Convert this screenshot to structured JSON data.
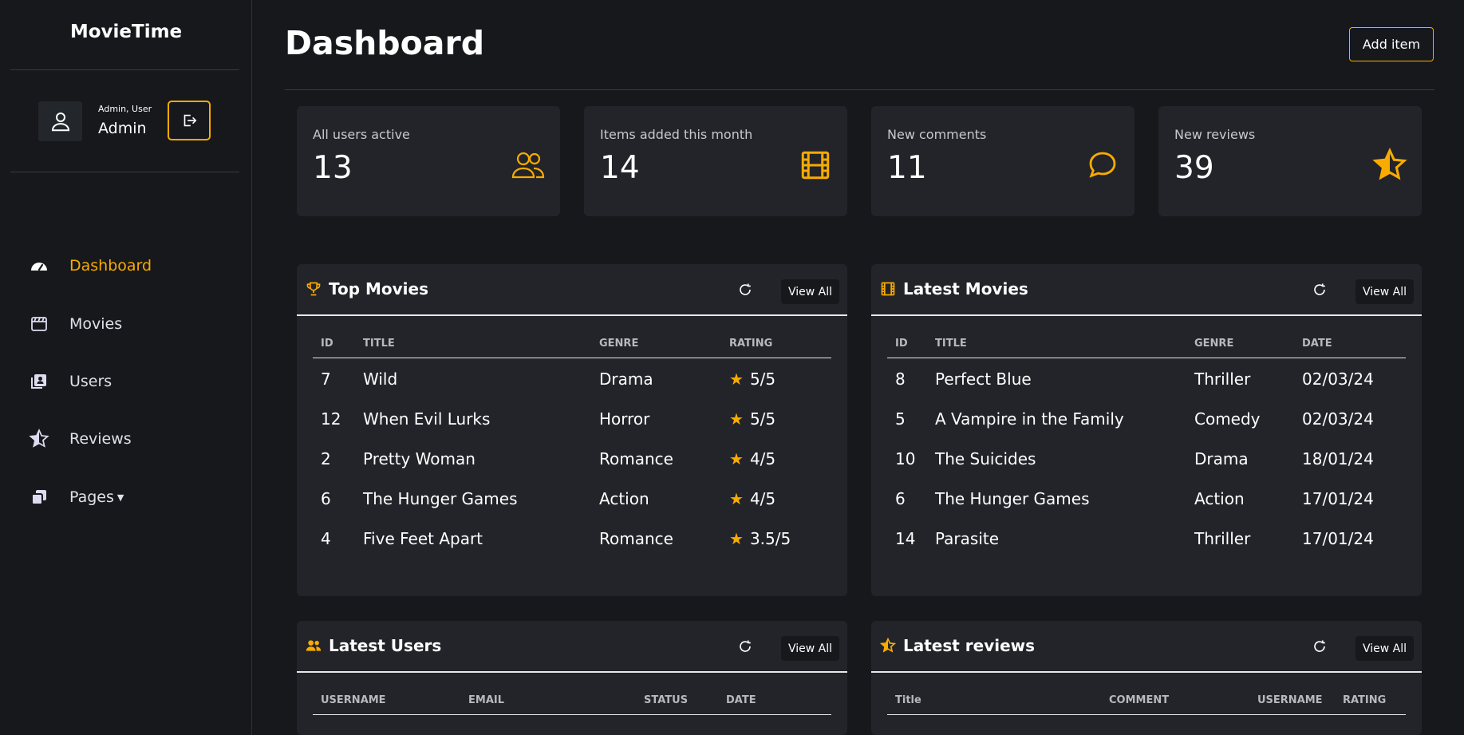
{
  "app": {
    "brand": "MovieTime"
  },
  "profile": {
    "role": "Admin, User",
    "name": "Admin"
  },
  "nav": [
    {
      "label": "Dashboard",
      "icon": "dashboard-gauge-icon",
      "active": true
    },
    {
      "label": "Movies",
      "icon": "film-clapper-icon",
      "active": false
    },
    {
      "label": "Users",
      "icon": "users-id-card-icon",
      "active": false
    },
    {
      "label": "Reviews",
      "icon": "star-half-icon",
      "active": false
    },
    {
      "label": "Pages",
      "icon": "pages-stack-icon",
      "dropdown": true,
      "active": false
    }
  ],
  "header": {
    "title": "Dashboard",
    "add_label": "Add item"
  },
  "stats": [
    {
      "label": "All users active",
      "value": "13",
      "icon": "users-icon"
    },
    {
      "label": "Items added this month",
      "value": "14",
      "icon": "film-icon"
    },
    {
      "label": "New comments",
      "value": "11",
      "icon": "comment-icon"
    },
    {
      "label": "New reviews",
      "value": "39",
      "icon": "star-half-icon"
    }
  ],
  "panels": {
    "view_all": "View All",
    "top_movies": {
      "title": "Top Movies",
      "columns": [
        "ID",
        "TITLE",
        "GENRE",
        "RATING"
      ],
      "rows": [
        {
          "id": "7",
          "title": "Wild",
          "genre": "Drama",
          "rating": "5/5"
        },
        {
          "id": "12",
          "title": "When Evil Lurks",
          "genre": "Horror",
          "rating": "5/5"
        },
        {
          "id": "2",
          "title": "Pretty Woman",
          "genre": "Romance",
          "rating": "4/5"
        },
        {
          "id": "6",
          "title": "The Hunger Games",
          "genre": "Action",
          "rating": "4/5"
        },
        {
          "id": "4",
          "title": "Five Feet Apart",
          "genre": "Romance",
          "rating": "3.5/5"
        }
      ]
    },
    "latest_movies": {
      "title": "Latest Movies",
      "columns": [
        "ID",
        "TITLE",
        "GENRE",
        "DATE"
      ],
      "rows": [
        {
          "id": "8",
          "title": "Perfect Blue",
          "genre": "Thriller",
          "date": "02/03/24"
        },
        {
          "id": "5",
          "title": "A Vampire in the Family",
          "genre": "Comedy",
          "date": "02/03/24"
        },
        {
          "id": "10",
          "title": "The Suicides",
          "genre": "Drama",
          "date": "18/01/24"
        },
        {
          "id": "6",
          "title": "The Hunger Games",
          "genre": "Action",
          "date": "17/01/24"
        },
        {
          "id": "14",
          "title": "Parasite",
          "genre": "Thriller",
          "date": "17/01/24"
        }
      ]
    },
    "latest_users": {
      "title": "Latest Users",
      "columns": [
        "USERNAME",
        "EMAIL",
        "STATUS",
        "DATE"
      ]
    },
    "latest_reviews": {
      "title": "Latest reviews",
      "columns": [
        "Title",
        "COMMENT",
        "USERNAME",
        "RATING"
      ]
    }
  },
  "colors": {
    "accent": "#f9ab00",
    "bg": "#17181c",
    "card": "#222429"
  }
}
